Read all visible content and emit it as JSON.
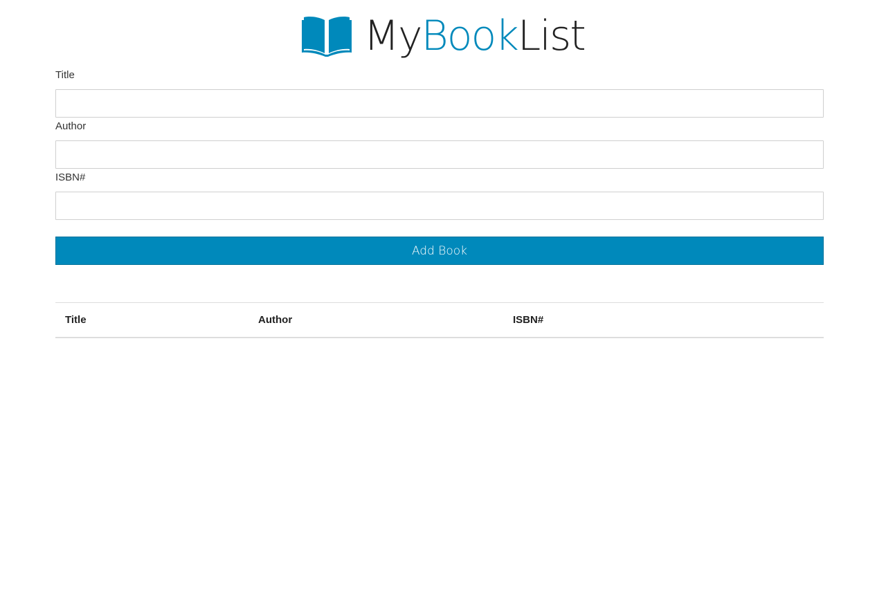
{
  "brand": {
    "part1": "My",
    "part2": "Book",
    "part3": "List",
    "icon": "open-book-icon",
    "accent_color": "#0089BB"
  },
  "form": {
    "title_label": "Title",
    "title_value": "",
    "author_label": "Author",
    "author_value": "",
    "isbn_label": "ISBN#",
    "isbn_value": "",
    "submit_label": "Add Book"
  },
  "table": {
    "columns": [
      "Title",
      "Author",
      "ISBN#"
    ],
    "rows": []
  }
}
